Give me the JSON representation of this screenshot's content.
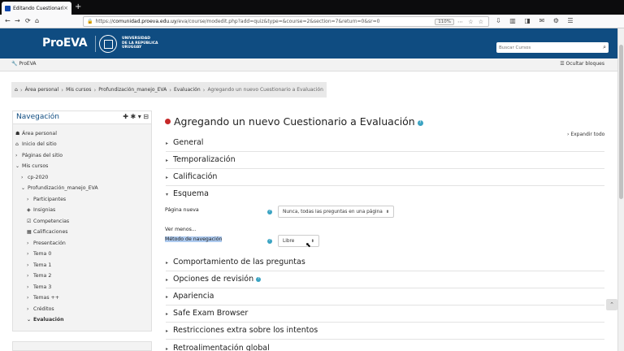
{
  "browser": {
    "tab_title": "Editando Cuestionario",
    "tab_close": "×",
    "new_tab": "+",
    "url_host": "comunidad.proeva.edu.uy",
    "url_prefix": "https://",
    "url_path": "/eva/course/modedit.php?add=quiz&type=&course=2&section=7&return=0&sr=0",
    "zoom": "110%",
    "back": "←",
    "forward": "→",
    "reload": "⟳",
    "home": "⌂",
    "url_icons": "⋯ ☆ ☆",
    "toolbar_icons": "⇩ ▥ ◨ ✉ ⚙ ☰"
  },
  "header": {
    "logo": "ProEVA",
    "university": [
      "UNIVERSIDAD",
      "DE LA REPÚBLICA",
      "URUGUAY"
    ],
    "search_placeholder": "Buscar Cursos",
    "search_icon": "⌕"
  },
  "subbar": {
    "site_label": "ProEVA",
    "site_icon": "🔧",
    "hide_blocks": "Ocultar bloques",
    "hide_icon": "☰"
  },
  "breadcrumb": {
    "home_icon": "⌂",
    "items": [
      "Área personal",
      "Mis cursos",
      "Profundización_manejo_EVA",
      "Evaluación"
    ],
    "current": "Agregando un nuevo Cuestionario a Evaluación",
    "separator": "›"
  },
  "navigation": {
    "title": "Navegación",
    "controls": "✚ ✱ ▾ ⊟",
    "items": [
      {
        "label": "Área personal",
        "glyph": "☗"
      },
      {
        "label": "Inicio del sitio",
        "glyph": "⌂"
      },
      {
        "label": "Páginas del sitio",
        "glyph": "›"
      },
      {
        "label": "Mis cursos",
        "glyph": "⌄"
      },
      {
        "label": "cp-2020",
        "glyph": "›"
      },
      {
        "label": "Profundización_manejo_EVA",
        "glyph": "⌄"
      },
      {
        "label": "Participantes",
        "glyph": "›"
      },
      {
        "label": "Insignias",
        "glyph": "◈"
      },
      {
        "label": "Competencias",
        "glyph": "☑"
      },
      {
        "label": "Calificaciones",
        "glyph": "▦"
      },
      {
        "label": "Presentación",
        "glyph": "›"
      },
      {
        "label": "Tema 0",
        "glyph": "›"
      },
      {
        "label": "Tema 1",
        "glyph": "›"
      },
      {
        "label": "Tema 2",
        "glyph": "›"
      },
      {
        "label": "Tema 3",
        "glyph": "›"
      },
      {
        "label": "Temas ++",
        "glyph": "›"
      },
      {
        "label": "Créditos",
        "glyph": "›"
      },
      {
        "label": "Evaluación",
        "glyph": "⌄"
      }
    ]
  },
  "main": {
    "title": "Agregando un nuevo Cuestionario a Evaluación",
    "help": "?",
    "expand_all": "Expandir todo",
    "expand_icon": "›",
    "sections": {
      "general": "General",
      "timing": "Temporalización",
      "grade": "Calificación",
      "layout": "Esquema",
      "behaviour": "Comportamiento de las preguntas",
      "review": "Opciones de revisión",
      "appearance": "Apariencia",
      "seb": "Safe Exam Browser",
      "restrictions": "Restricciones extra sobre los intentos",
      "feedback": "Retroalimentación global"
    },
    "layout_fields": {
      "new_page_label": "Página nueva",
      "new_page_value": "Nunca, todas las preguntas en una página",
      "show_less": "Ver menos...",
      "nav_method_label": "Método de navegación",
      "nav_method_value": "Libre"
    },
    "caret": "⬍",
    "arrow_collapsed": "▸",
    "arrow_expanded": "▾",
    "to_top": "⌃"
  }
}
